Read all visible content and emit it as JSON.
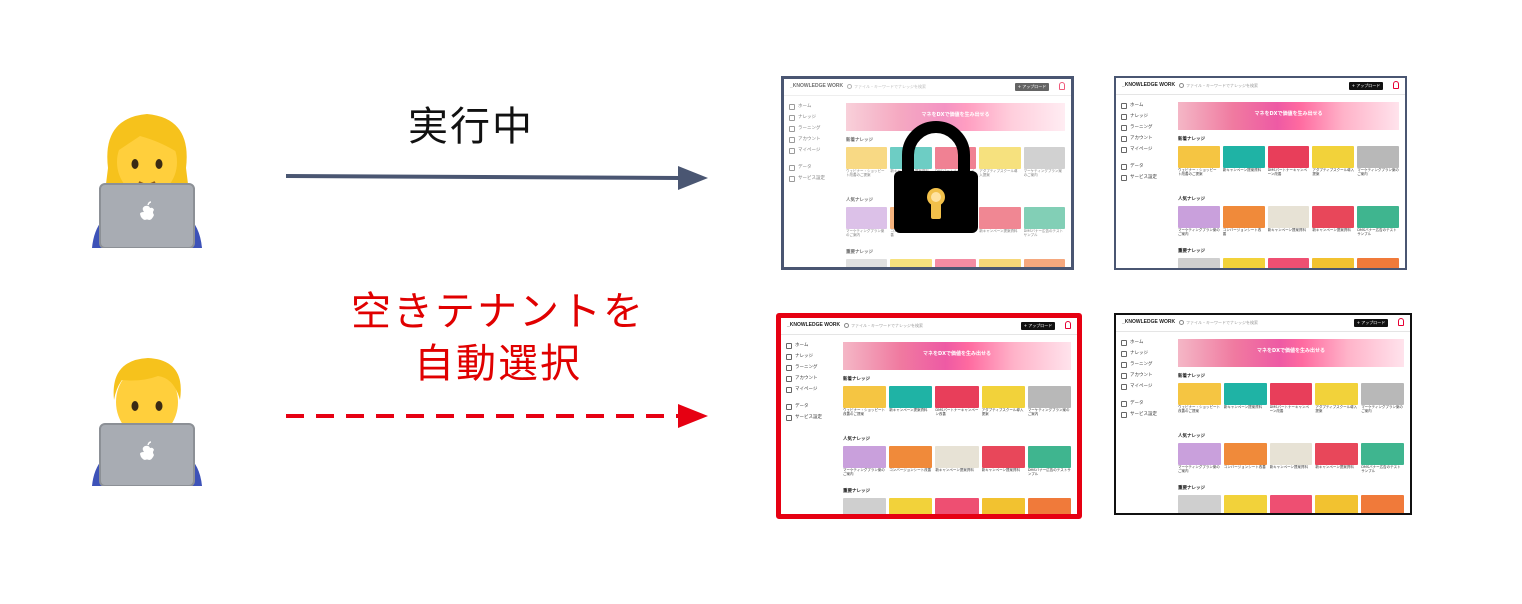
{
  "labels": {
    "running": "実行中",
    "auto_select_line1": "空きテナントを",
    "auto_select_line2": "自動選択"
  },
  "colors": {
    "arrow_gray": "#4a5672",
    "arrow_red": "#e60012",
    "label_red": "#e00000",
    "selected_border": "#e60012",
    "brand_red": "#e60033"
  },
  "icons": {
    "top_person": "woman-technologist-emoji",
    "bottom_person": "man-technologist-emoji",
    "lock": "padlock-icon"
  },
  "app": {
    "logo": "_KNOWLEDGE WORK",
    "search_placeholder": "ファイル・キーワードでナレッジを検索",
    "upload_button": "+ アップロード",
    "hero_text": "マネをDXで価値を生み出せる",
    "sidebar": [
      "ホーム",
      "ナレッジ",
      "ラーニング",
      "アカウント",
      "マイページ",
      "データ",
      "サービス設定"
    ],
    "sections": [
      "新着ナレッジ",
      "人気ナレッジ",
      "重要ナレッジ"
    ],
    "captions_row1": [
      "ウェビナー・ショッピート改善のご提案",
      "新キャンペーン提案資料",
      "DMSパートナーキャンペーン改善",
      "アダプティブスクール導入提案",
      "マーケティングプラン案のご案内"
    ],
    "captions_row2": [
      "マーケティングプラン案のご案内",
      "コンバージョンシート改善",
      "新キャンペーン提案資料",
      "新キャンペーン提案資料",
      "DMSバナー広告のテストサンプル"
    ]
  }
}
